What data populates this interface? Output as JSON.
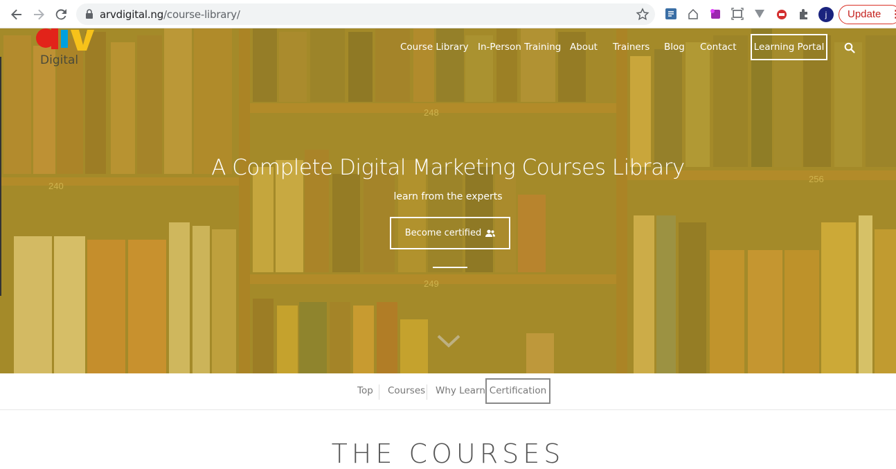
{
  "browser": {
    "url_host": "arvdigital.ng",
    "url_path": "/course-library/",
    "profile_initial": "j",
    "update_label": "Update"
  },
  "site": {
    "logo_text": "Digital",
    "nav": [
      "Course Library",
      "In-Person Training",
      "About",
      "Trainers",
      "Blog",
      "Contact"
    ],
    "portal_label": "Learning Portal"
  },
  "hero": {
    "headline": "A Complete Digital Marketing Courses Library",
    "subheadline": "learn from the experts",
    "cta_label": "Become certified",
    "shelf_labels": [
      "248",
      "240",
      "256",
      "249"
    ]
  },
  "tabs": {
    "items": [
      "Top",
      "Courses",
      "Why Learn"
    ],
    "active": "Certification"
  },
  "section": {
    "peek_title": "THE COURSES"
  },
  "colors": {
    "overlay": "#d4b432",
    "update_red": "#c5221f"
  }
}
